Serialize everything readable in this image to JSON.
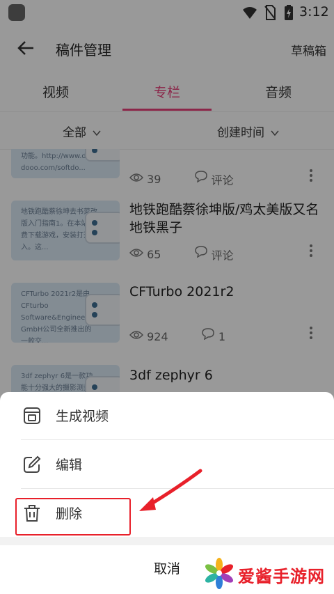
{
  "status_bar": {
    "time": "3:12"
  },
  "header": {
    "title": "稿件管理",
    "drafts_label": "草稿箱"
  },
  "tabs": [
    {
      "label": "视频",
      "active": false
    },
    {
      "label": "专栏",
      "active": true
    },
    {
      "label": "音频",
      "active": false
    }
  ],
  "filters": {
    "category": "全部",
    "sort": "创建时间"
  },
  "articles": [
    {
      "title": "",
      "thumb_text": "功能。http://www.d dooo.com/softdo...",
      "views": "39",
      "comments": "评论"
    },
    {
      "title": "地铁跑酷蔡徐坤版/鸡太美版又名地铁黑子",
      "thumb_text": "地铁跑酷蔡徐坤去书菜改版入门指南1。在本站免费下载游戏，安装打开进入。这...",
      "views": "65",
      "comments": "评论"
    },
    {
      "title": "CFTurbo 2021r2",
      "thumb_text": "CFTurbo 2021r2是由CFturbo Software&Engineering GmbH公司全新推出的一款交...",
      "views": "924",
      "comments": "1"
    },
    {
      "title": "3df zephyr 6",
      "thumb_text": "3df zephyr 6是一款功能十分强大的摄影测量",
      "views": "",
      "comments": ""
    }
  ],
  "action_sheet": {
    "items": [
      {
        "label": "生成视频",
        "icon": "video-frame-icon"
      },
      {
        "label": "编辑",
        "icon": "edit-icon"
      },
      {
        "label": "删除",
        "icon": "trash-icon"
      }
    ],
    "cancel_label": "取消"
  },
  "watermark": {
    "text": "爱酱手游网"
  },
  "colors": {
    "accent": "#e8407a",
    "highlight_box": "#e8202a",
    "thumb_bg": "#dbe9f6"
  }
}
